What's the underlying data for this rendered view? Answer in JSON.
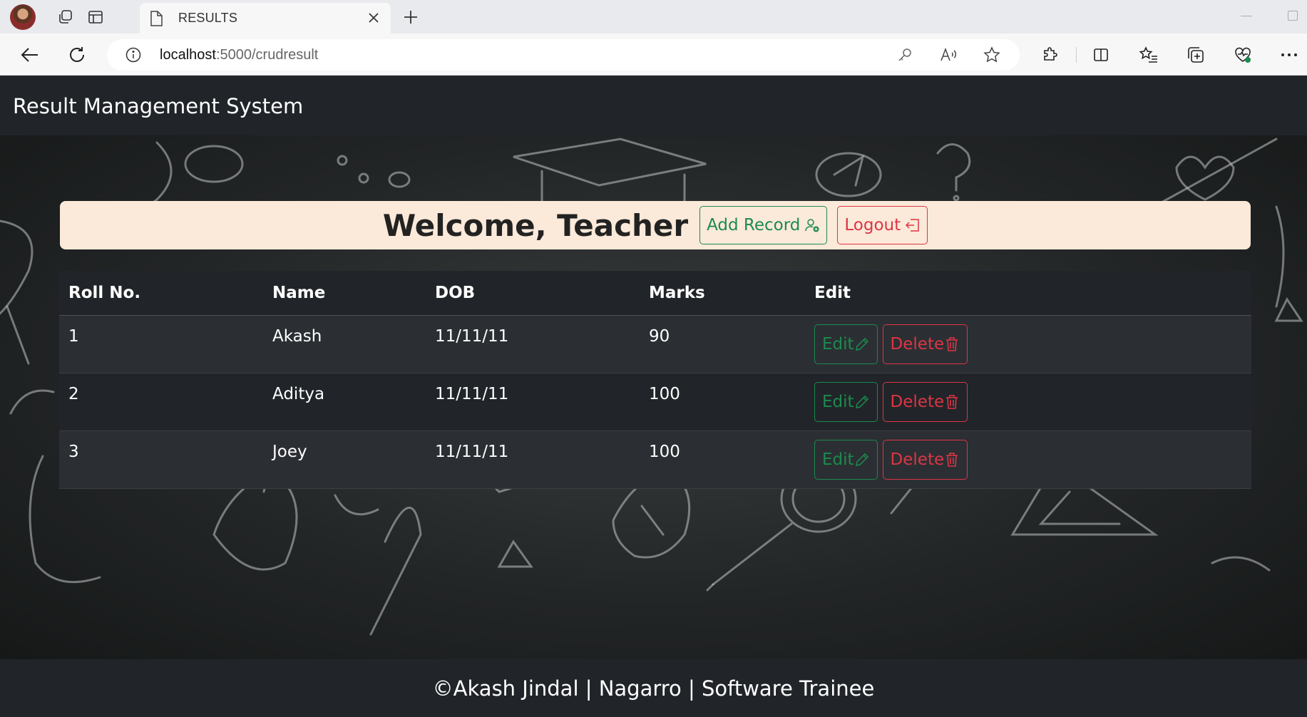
{
  "browser": {
    "tab_title": "RESULTS",
    "url_host": "localhost",
    "url_path": ":5000/crudresult"
  },
  "navbar": {
    "brand": "Result Management System"
  },
  "welcome": {
    "title": "Welcome, Teacher",
    "add_record_label": "Add Record",
    "logout_label": "Logout"
  },
  "table": {
    "headers": [
      "Roll No.",
      "Name",
      "DOB",
      "Marks",
      "Edit"
    ],
    "rows": [
      {
        "roll": "1",
        "name": "Akash",
        "dob": "11/11/11",
        "marks": "90"
      },
      {
        "roll": "2",
        "name": "Aditya",
        "dob": "11/11/11",
        "marks": "100"
      },
      {
        "roll": "3",
        "name": "Joey",
        "dob": "11/11/11",
        "marks": "100"
      }
    ],
    "edit_label": "Edit",
    "delete_label": "Delete"
  },
  "footer": {
    "text": "©Akash Jindal | Nagarro | Software Trainee"
  },
  "colors": {
    "navbar_bg": "#212529",
    "card_bg": "#fbe9d9",
    "success": "#1c8a4e",
    "danger": "#dc3545"
  }
}
